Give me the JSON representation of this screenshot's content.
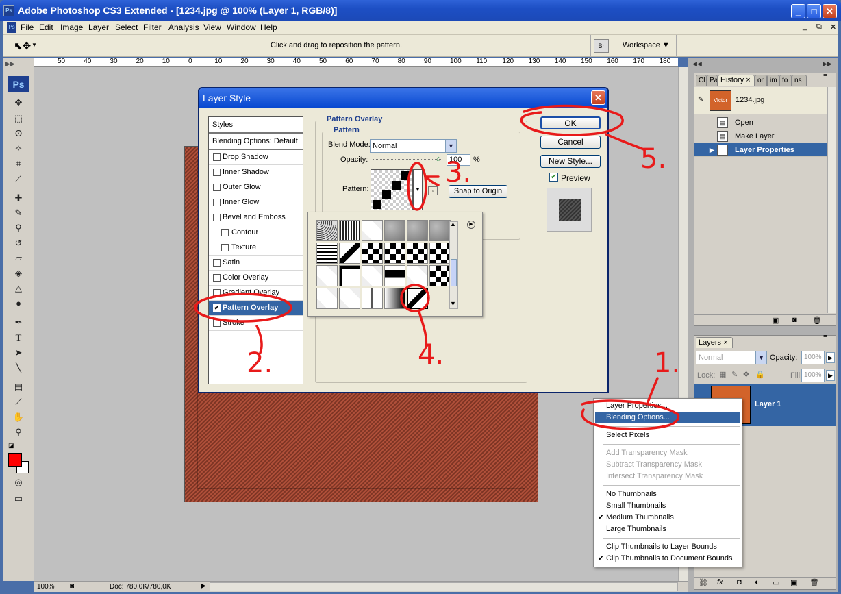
{
  "window": {
    "title": "Adobe Photoshop CS3 Extended - [1234.jpg @ 100% (Layer 1, RGB/8)]",
    "app_icon": "Ps"
  },
  "menu": [
    "File",
    "Edit",
    "Image",
    "Layer",
    "Select",
    "Filter",
    "Analysis",
    "View",
    "Window",
    "Help"
  ],
  "options_bar": {
    "hint": "Click and drag to reposition the pattern.",
    "workspace_label": "Workspace"
  },
  "ruler_top": [
    "50",
    "40",
    "30",
    "20",
    "10",
    "0",
    "10",
    "20",
    "30",
    "40",
    "50",
    "60",
    "70",
    "80",
    "90",
    "100",
    "110",
    "120",
    "130",
    "140",
    "150",
    "160",
    "170",
    "180"
  ],
  "ruler_left": [
    "0",
    "1",
    "2",
    "3",
    "4",
    "5",
    "6",
    "7",
    "8",
    "9",
    "1",
    "1",
    "2",
    "3",
    "4",
    "5",
    "6",
    "7",
    "8",
    "9"
  ],
  "toolbox": {
    "logo": "Ps",
    "foreground_color": "#ff0000"
  },
  "status": {
    "zoom": "100%",
    "doc": "Doc: 780,0K/780,0K"
  },
  "history_panel": {
    "tabs": [
      "Cl",
      "Pa",
      "History",
      "or",
      "im",
      "fo",
      "ns"
    ],
    "snapshot_name": "1234.jpg",
    "snapshot_thumb_text": "Victor",
    "items": [
      "Open",
      "Make Layer",
      "Layer Properties"
    ]
  },
  "layers_panel": {
    "tab": "Layers",
    "blend_mode": "Normal",
    "opacity_label": "Opacity:",
    "opacity": "100%",
    "lock_label": "Lock:",
    "fill_label": "Fill:",
    "fill": "100%",
    "layer_name": "Layer 1"
  },
  "dialog": {
    "title": "Layer Style",
    "styles_header": "Styles",
    "styles": [
      "Blending Options: Default",
      "Drop Shadow",
      "Inner Shadow",
      "Outer Glow",
      "Inner Glow",
      "Bevel and Emboss",
      "Contour",
      "Texture",
      "Satin",
      "Color Overlay",
      "Gradient Overlay",
      "Pattern Overlay",
      "Stroke"
    ],
    "section_title": "Pattern Overlay",
    "group_title": "Pattern",
    "blend_mode_label": "Blend Mode:",
    "blend_mode": "Normal",
    "opacity_label": "Opacity:",
    "opacity": "100",
    "percent": "%",
    "pattern_label": "Pattern:",
    "snap_button": "Snap to Origin",
    "ok": "OK",
    "cancel": "Cancel",
    "new_style": "New Style...",
    "preview": "Preview"
  },
  "context_menu": {
    "items": [
      {
        "label": "Layer Properties...",
        "state": "normal"
      },
      {
        "label": "Blending Options...",
        "state": "highlighted"
      },
      {
        "label": "Select Pixels",
        "state": "normal"
      },
      {
        "label": "Add Transparency Mask",
        "state": "disabled"
      },
      {
        "label": "Subtract Transparency Mask",
        "state": "disabled"
      },
      {
        "label": "Intersect Transparency Mask",
        "state": "disabled"
      },
      {
        "label": "No Thumbnails",
        "state": "normal"
      },
      {
        "label": "Small Thumbnails",
        "state": "normal"
      },
      {
        "label": "Medium Thumbnails",
        "state": "checked"
      },
      {
        "label": "Large Thumbnails",
        "state": "normal"
      },
      {
        "label": "Clip Thumbnails to Layer Bounds",
        "state": "normal"
      },
      {
        "label": "Clip Thumbnails to Document Bounds",
        "state": "checked"
      }
    ],
    "check_mark": "✔"
  },
  "annotations": [
    "1.",
    "2.",
    "3.",
    "4.",
    "5."
  ],
  "colors": {
    "title_blue": "#1d4fc4",
    "selection": "#3465a4",
    "annotation_red": "#e81a1a",
    "image_fill": "#9a4430"
  }
}
